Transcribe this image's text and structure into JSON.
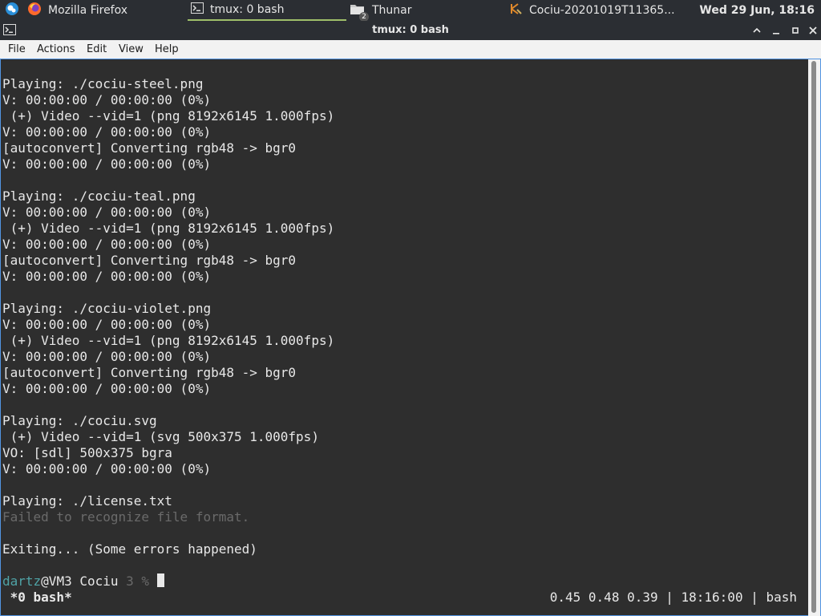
{
  "panel": {
    "tasks": [
      {
        "label": "Mozilla Firefox",
        "icon": "firefox-icon"
      },
      {
        "label": "tmux: 0 bash",
        "icon": "terminal-icon"
      },
      {
        "label": "Thunar",
        "icon": "folder-icon",
        "badge": "2"
      },
      {
        "label": "Cociu-20201019T11365...",
        "icon": "inkscape-icon"
      }
    ],
    "clock": "Wed 29 Jun, 18:16"
  },
  "window": {
    "title": "tmux: 0 bash"
  },
  "menu": {
    "items": [
      "File",
      "Actions",
      "Edit",
      "View",
      "Help"
    ]
  },
  "terminal": {
    "lines": [
      "",
      "Playing: ./cociu-steel.png",
      "V: 00:00:00 / 00:00:00 (0%)",
      " (+) Video --vid=1 (png 8192x6145 1.000fps)",
      "V: 00:00:00 / 00:00:00 (0%)",
      "[autoconvert] Converting rgb48 -> bgr0",
      "V: 00:00:00 / 00:00:00 (0%)",
      "",
      "Playing: ./cociu-teal.png",
      "V: 00:00:00 / 00:00:00 (0%)",
      " (+) Video --vid=1 (png 8192x6145 1.000fps)",
      "V: 00:00:00 / 00:00:00 (0%)",
      "[autoconvert] Converting rgb48 -> bgr0",
      "V: 00:00:00 / 00:00:00 (0%)",
      "",
      "Playing: ./cociu-violet.png",
      "V: 00:00:00 / 00:00:00 (0%)",
      " (+) Video --vid=1 (png 8192x6145 1.000fps)",
      "V: 00:00:00 / 00:00:00 (0%)",
      "[autoconvert] Converting rgb48 -> bgr0",
      "V: 00:00:00 / 00:00:00 (0%)",
      "",
      "Playing: ./cociu.svg",
      " (+) Video --vid=1 (svg 500x375 1.000fps)",
      "VO: [sdl] 500x375 bgra",
      "V: 00:00:00 / 00:00:00 (0%)",
      "",
      "Playing: ./license.txt",
      "Failed to recognize file format.",
      "",
      "Exiting... (Some errors happened)",
      ""
    ],
    "prompt": {
      "user": "dartz",
      "host": "@VM3 Cociu ",
      "num": "3",
      "sign": " % "
    },
    "status_left": " *0 bash*",
    "status_right": "0.45 0.48 0.39 | 18:16:00 | bash"
  }
}
